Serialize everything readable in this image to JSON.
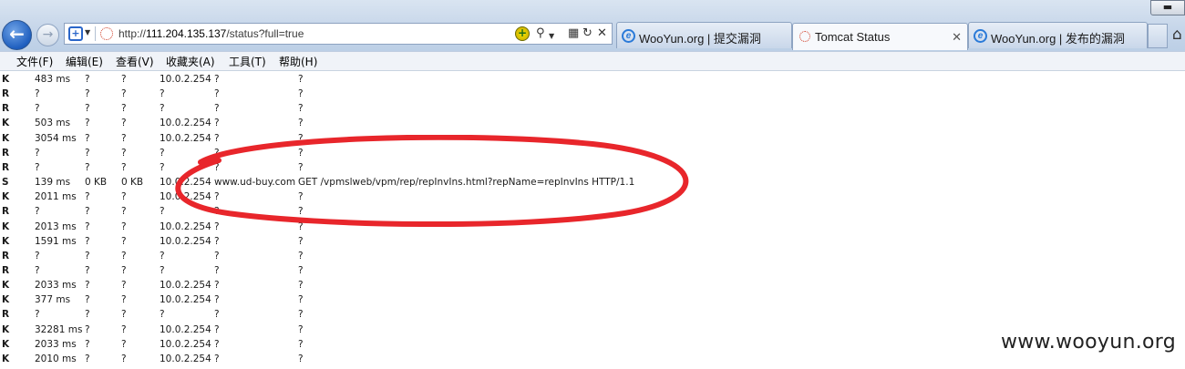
{
  "browser": {
    "address": {
      "scheme": "http://",
      "host": "111.204.135.137",
      "path": "/status?full=true"
    },
    "tabs": [
      {
        "label": "WooYun.org | 提交漏洞",
        "active": false,
        "icon": "ie-icon"
      },
      {
        "label": "Tomcat Status",
        "active": true,
        "icon": "tomcat-icon"
      },
      {
        "label": "WooYun.org | 发布的漏洞",
        "active": false,
        "icon": "ie-icon"
      }
    ]
  },
  "menu": [
    {
      "label": "文件(F)"
    },
    {
      "label": "编辑(E)"
    },
    {
      "label": "查看(V)"
    },
    {
      "label": "收藏夹(A)"
    },
    {
      "label": "工具(T)"
    },
    {
      "label": "帮助(H)"
    }
  ],
  "rows": [
    {
      "stage": "K",
      "time": "483 ms",
      "sent": "?",
      "recv": "?",
      "client": "10.0.2.254",
      "vhost": "?",
      "request": "?"
    },
    {
      "stage": "R",
      "time": "?",
      "sent": "?",
      "recv": "?",
      "client": "?",
      "vhost": "?",
      "request": "?"
    },
    {
      "stage": "R",
      "time": "?",
      "sent": "?",
      "recv": "?",
      "client": "?",
      "vhost": "?",
      "request": "?"
    },
    {
      "stage": "K",
      "time": "503 ms",
      "sent": "?",
      "recv": "?",
      "client": "10.0.2.254",
      "vhost": "?",
      "request": "?"
    },
    {
      "stage": "K",
      "time": "3054 ms",
      "sent": "?",
      "recv": "?",
      "client": "10.0.2.254",
      "vhost": "?",
      "request": "?"
    },
    {
      "stage": "R",
      "time": "?",
      "sent": "?",
      "recv": "?",
      "client": "?",
      "vhost": "?",
      "request": "?"
    },
    {
      "stage": "R",
      "time": "?",
      "sent": "?",
      "recv": "?",
      "client": "?",
      "vhost": "?",
      "request": "?"
    },
    {
      "stage": "S",
      "time": "139 ms",
      "sent": "0 KB",
      "recv": "0 KB",
      "client": "10.0.2.254",
      "vhost": "www.ud-buy.com",
      "request": "GET /vpmslweb/vpm/rep/repInvIns.html?repName=repInvIns HTTP/1.1"
    },
    {
      "stage": "K",
      "time": "2011 ms",
      "sent": "?",
      "recv": "?",
      "client": "10.0.2.254",
      "vhost": "?",
      "request": "?"
    },
    {
      "stage": "R",
      "time": "?",
      "sent": "?",
      "recv": "?",
      "client": "?",
      "vhost": "?",
      "request": "?"
    },
    {
      "stage": "K",
      "time": "2013 ms",
      "sent": "?",
      "recv": "?",
      "client": "10.0.2.254",
      "vhost": "?",
      "request": "?"
    },
    {
      "stage": "K",
      "time": "1591 ms",
      "sent": "?",
      "recv": "?",
      "client": "10.0.2.254",
      "vhost": "?",
      "request": "?"
    },
    {
      "stage": "R",
      "time": "?",
      "sent": "?",
      "recv": "?",
      "client": "?",
      "vhost": "?",
      "request": "?"
    },
    {
      "stage": "R",
      "time": "?",
      "sent": "?",
      "recv": "?",
      "client": "?",
      "vhost": "?",
      "request": "?"
    },
    {
      "stage": "K",
      "time": "2033 ms",
      "sent": "?",
      "recv": "?",
      "client": "10.0.2.254",
      "vhost": "?",
      "request": "?"
    },
    {
      "stage": "K",
      "time": "377 ms",
      "sent": "?",
      "recv": "?",
      "client": "10.0.2.254",
      "vhost": "?",
      "request": "?"
    },
    {
      "stage": "R",
      "time": "?",
      "sent": "?",
      "recv": "?",
      "client": "?",
      "vhost": "?",
      "request": "?"
    },
    {
      "stage": "K",
      "time": "32281 ms",
      "sent": "?",
      "recv": "?",
      "client": "10.0.2.254",
      "vhost": "?",
      "request": "?"
    },
    {
      "stage": "K",
      "time": "2033 ms",
      "sent": "?",
      "recv": "?",
      "client": "10.0.2.254",
      "vhost": "?",
      "request": "?"
    },
    {
      "stage": "K",
      "time": "2010 ms",
      "sent": "?",
      "recv": "?",
      "client": "10.0.2.254",
      "vhost": "?",
      "request": "?"
    }
  ],
  "annotation_color": "#e8262b",
  "watermark": "www.wooyun.org"
}
